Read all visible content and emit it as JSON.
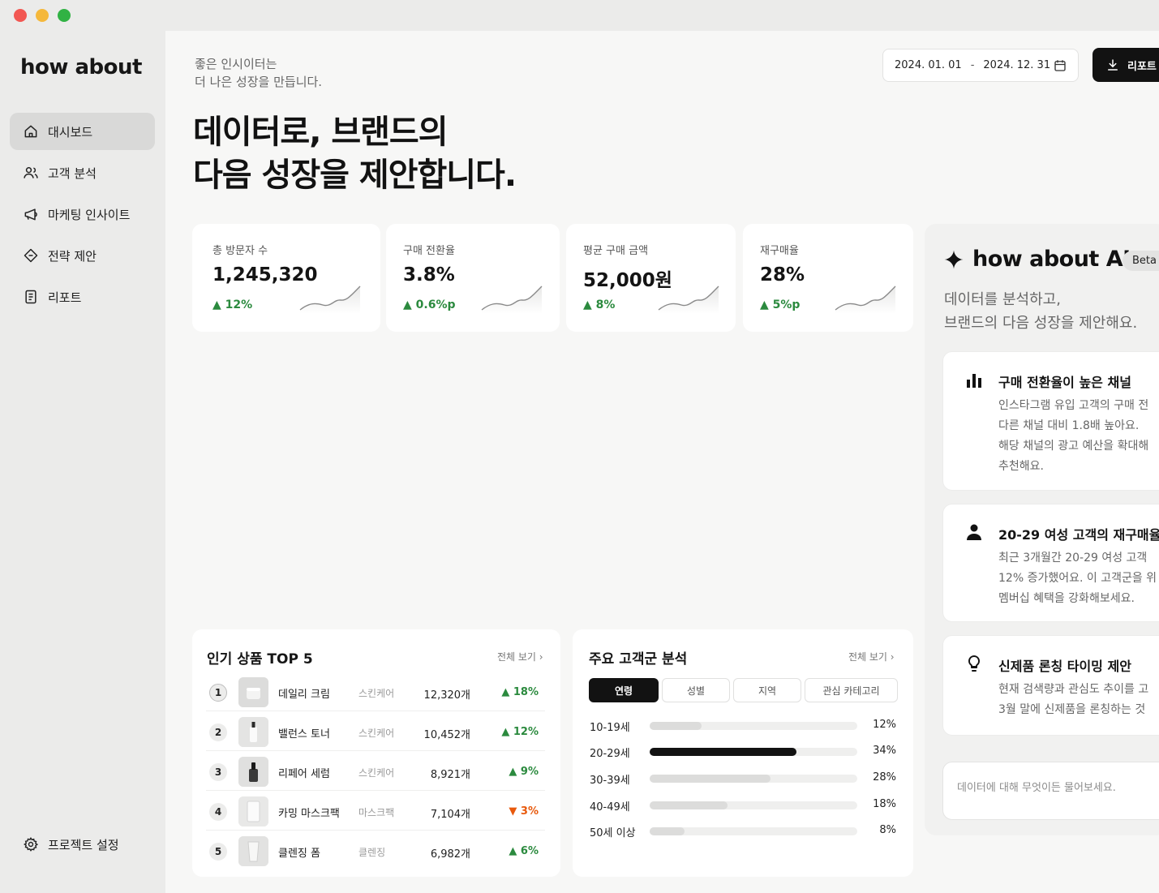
{
  "window": {
    "traffic_lights": [
      "close",
      "minimize",
      "zoom"
    ]
  },
  "sidebar": {
    "logo": "how about",
    "items": [
      {
        "label": "대시보드",
        "icon": "home-icon",
        "active": true
      },
      {
        "label": "고객 분석",
        "icon": "users-icon"
      },
      {
        "label": "마케팅 인사이트",
        "icon": "megaphone-icon"
      },
      {
        "label": "전략 제안",
        "icon": "diamond-icon"
      },
      {
        "label": "리포트",
        "icon": "document-icon"
      }
    ],
    "settings_label": "프로젝트 설정"
  },
  "header": {
    "kicker_line1": "좋은 인시이터는",
    "kicker_line2": "더 나은 성장을 만듭니다.",
    "headline_line1": "데이터로, 브랜드의",
    "headline_line2": "다음 성장을 제안합니다.",
    "date_start": "2024. 01. 01",
    "date_sep": "-",
    "date_end": "2024. 12. 31",
    "report_button": "리포트"
  },
  "kpis": [
    {
      "label": "총 방문자 수",
      "value": "1,245,320",
      "delta": "▲ 12%"
    },
    {
      "label": "구매 전환율",
      "value": "3.8%",
      "delta": "▲ 0.6%p"
    },
    {
      "label": "평균 구매 금액",
      "value": "52,000원",
      "delta": "▲ 8%"
    },
    {
      "label": "재구매율",
      "value": "28%",
      "delta": "▲ 5%p"
    }
  ],
  "products": {
    "title": "인기 상품 TOP 5",
    "view_all": "전체 보기 ›",
    "rows": [
      {
        "rank": "1",
        "name": "데일리 크림",
        "category": "스킨케어",
        "count": "12,320개",
        "delta": "▲ 18%",
        "trend": "up"
      },
      {
        "rank": "2",
        "name": "밸런스 토너",
        "category": "스킨케어",
        "count": "10,452개",
        "delta": "▲ 12%",
        "trend": "up"
      },
      {
        "rank": "3",
        "name": "리페어 세럼",
        "category": "스킨케어",
        "count": "8,921개",
        "delta": "▲ 9%",
        "trend": "up"
      },
      {
        "rank": "4",
        "name": "카밍 마스크팩",
        "category": "마스크팩",
        "count": "7,104개",
        "delta": "▼ 3%",
        "trend": "down"
      },
      {
        "rank": "5",
        "name": "클렌징 폼",
        "category": "클렌징",
        "count": "6,982개",
        "delta": "▲ 6%",
        "trend": "up"
      }
    ]
  },
  "segments": {
    "title": "주요 고객군 분석",
    "view_all": "전체 보기 ›",
    "tabs": [
      "연령",
      "성별",
      "지역",
      "관심 카테고리"
    ],
    "active_tab": 0,
    "rows": [
      {
        "label": "10-19세",
        "pct": "12%",
        "value": 12
      },
      {
        "label": "20-29세",
        "pct": "34%",
        "value": 34
      },
      {
        "label": "30-39세",
        "pct": "28%",
        "value": 28
      },
      {
        "label": "40-49세",
        "pct": "18%",
        "value": 18
      },
      {
        "label": "50세 이상",
        "pct": "8%",
        "value": 8
      }
    ]
  },
  "ai": {
    "title": "how about AI",
    "badge": "Beta",
    "subtitle_line1": "데이터를 분석하고,",
    "subtitle_line2": "브랜드의 다음 성장을 제안해요.",
    "cards": [
      {
        "icon": "bar-chart-icon",
        "title": "구매 전환율이 높은 채널",
        "lines": [
          "인스타그램 유입 고객의 구매 전",
          "다른 채널 대비 1.8배 높아요.",
          "해당 채널의 광고 예산을 확대해",
          "추천해요."
        ]
      },
      {
        "icon": "person-icon",
        "title": "20-29 여성 고객의 재구매율",
        "lines": [
          "최근 3개월간 20-29 여성 고객",
          "12% 증가했어요. 이 고객군을 위",
          "멤버십 혜택을 강화해보세요."
        ]
      },
      {
        "icon": "lightbulb-icon",
        "title": "신제품 론칭 타이밍 제안",
        "lines": [
          "현재 검색량과 관심도 추이를 고",
          "3월 말에 신제품을 론칭하는 것"
        ]
      }
    ],
    "input_placeholder": "데이터에 대해 무엇이든 물어보세요."
  }
}
